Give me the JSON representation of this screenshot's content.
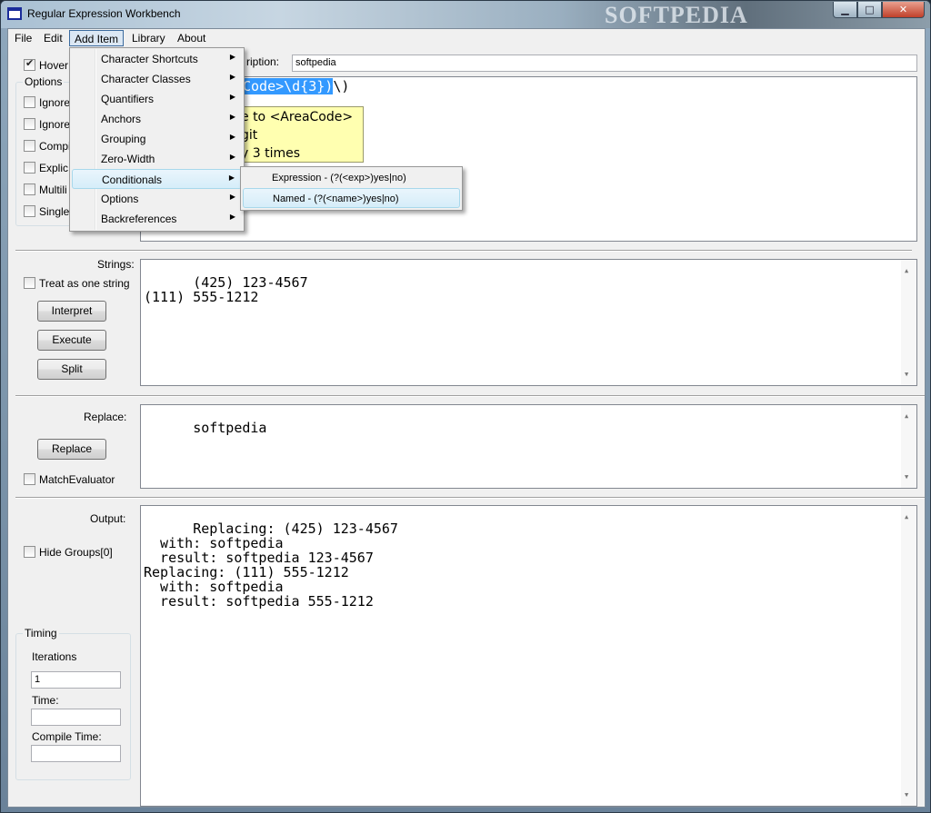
{
  "window": {
    "title": "Regular Expression Workbench",
    "watermark": "SOFTPEDIA",
    "min_glyph": "▁",
    "max_glyph": "□",
    "close_glyph": "✕"
  },
  "menubar": {
    "items": [
      "File",
      "Edit",
      "Add Item",
      "Library",
      "About"
    ],
    "active": "Add Item"
  },
  "add_item_menu": {
    "items": [
      "Character Shortcuts",
      "Character Classes",
      "Quantifiers",
      "Anchors",
      "Grouping",
      "Zero-Width",
      "Conditionals",
      "Options",
      "Backreferences"
    ],
    "highlighted": "Conditionals"
  },
  "conditionals_submenu": {
    "items": [
      "Expression - (?(<exp>)yes|no)",
      "Named - (?(<name>)yes|no)"
    ],
    "highlighted": "Named - (?(<name>)yes|no)"
  },
  "top_panel": {
    "hover_label": "Hover",
    "hover_checked": true,
    "description_label": "ription:",
    "description_value": "softpedia",
    "options_title": "Options",
    "options": [
      "Ignore",
      "Ignore",
      "Compi",
      "Explic",
      "Multili",
      "Single"
    ],
    "regex_visible_selected": "Code>\\d{3})",
    "regex_visible_rest": "\\)",
    "tooltip_lines": [
      "e to <AreaCode>",
      "git",
      "y 3 times"
    ]
  },
  "strings_panel": {
    "label": "Strings:",
    "treat_label": "Treat as one string",
    "buttons": [
      "Interpret",
      "Execute",
      "Split"
    ],
    "text": "(425) 123-4567\n(111) 555-1212"
  },
  "replace_panel": {
    "label": "Replace:",
    "button": "Replace",
    "match_evaluator_label": "MatchEvaluator",
    "text": "softpedia"
  },
  "output_panel": {
    "label": "Output:",
    "hide_groups_label": "Hide Groups[0]",
    "text": "Replacing: (425) 123-4567\n  with: softpedia\n  result: softpedia 123-4567\nReplacing: (111) 555-1212\n  with: softpedia\n  result: softpedia 555-1212"
  },
  "timing": {
    "title": "Timing",
    "iterations_label": "Iterations",
    "iterations_value": "1",
    "time_label": "Time:",
    "time_value": "",
    "compile_label": "Compile Time:",
    "compile_value": ""
  },
  "icons": {
    "scroll_up": "▲",
    "scroll_down": "▼",
    "submenu_arrow": "▶"
  }
}
